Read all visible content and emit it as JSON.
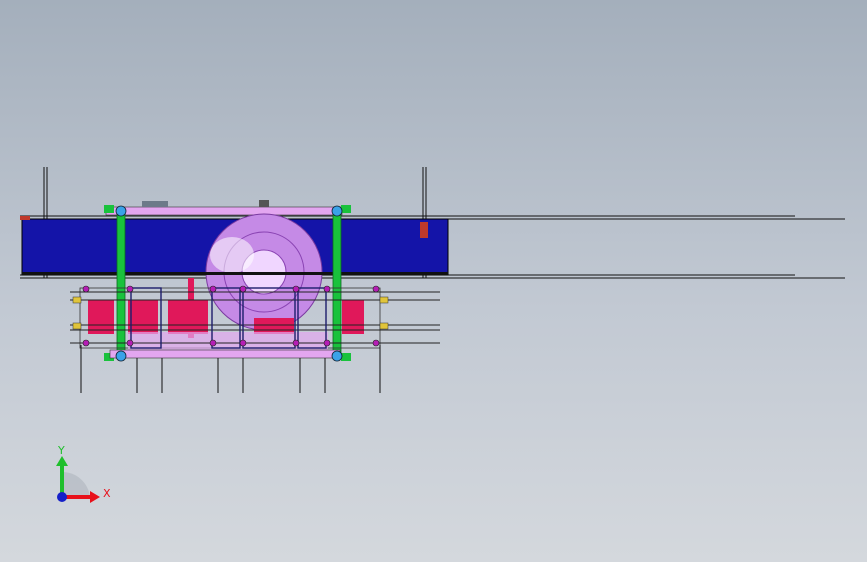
{
  "viewport": {
    "background_top": "#a4afbc",
    "background_bottom": "#d4d8dd"
  },
  "triad": {
    "x_label": "X",
    "y_label": "Y",
    "x_color": "#e8101a",
    "y_color": "#1fbf2c",
    "z_color": "#1520c8"
  },
  "model_colors": {
    "beam": "#1414a8",
    "frame": "#19c23c",
    "plate": "#e3a6f0",
    "disc": "#c58ae6",
    "housing": "#e0185a",
    "pin": "#b51eb5",
    "node": "#3aa2e8"
  }
}
